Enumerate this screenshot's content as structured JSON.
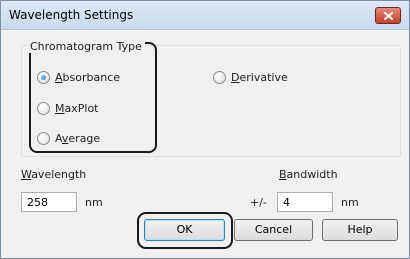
{
  "window": {
    "title": "Wavelength Settings"
  },
  "chromatogram": {
    "legend": "Chromatogram Type",
    "options": [
      {
        "label": "Absorbance",
        "underline": "A",
        "checked": true
      },
      {
        "label": "MaxPlot",
        "underline": "M",
        "checked": false
      },
      {
        "label": "Average",
        "underline": "v",
        "checked": false
      },
      {
        "label": "Derivative",
        "underline": "D",
        "checked": false
      }
    ]
  },
  "wavelength": {
    "label": "Wavelength",
    "value": "258",
    "unit": "nm"
  },
  "bandwidth": {
    "label": "Bandwidth",
    "prefix": "+/-",
    "value": "4",
    "unit": "nm"
  },
  "buttons": {
    "ok": "OK",
    "cancel": "Cancel",
    "help": "Help"
  },
  "icons": {
    "close": "close-icon"
  }
}
